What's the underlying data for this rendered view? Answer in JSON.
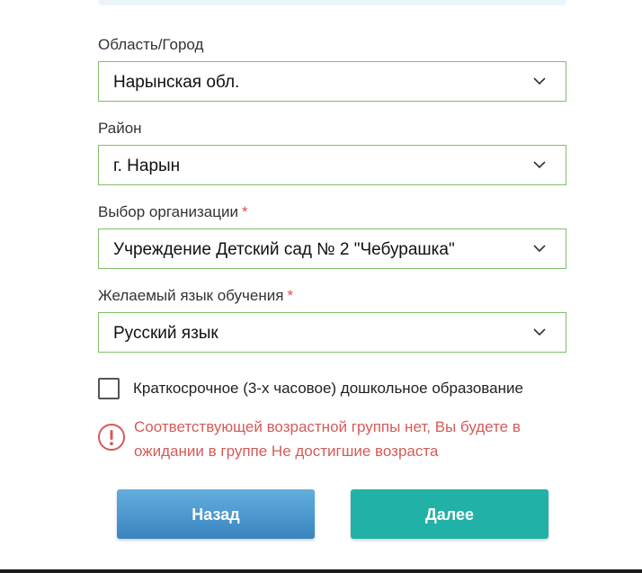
{
  "form": {
    "region": {
      "label": "Область/Город",
      "value": "Нарынская обл."
    },
    "district": {
      "label": "Район",
      "value": "г. Нарын"
    },
    "organization": {
      "label": "Выбор организации",
      "required_mark": "*",
      "value": "Учреждение Детский сад № 2 \"Чебурашка\""
    },
    "language": {
      "label": "Желаемый язык обучения",
      "required_mark": "*",
      "value": "Русский язык"
    },
    "short_term": {
      "label": "Краткосрочное (3-х часовое) дошкольное образование",
      "checked": false
    },
    "warning": {
      "icon": "exclamation-circle-icon",
      "text": "Соответствующей возрастной группы нет, Вы будете в ожидании в группе Не достигшие возраста"
    }
  },
  "buttons": {
    "back_label": "Назад",
    "next_label": "Далее"
  },
  "colors": {
    "select_border": "#7fbf6a",
    "required": "#d9534f",
    "warning": "#d45b58",
    "back_button": "#4a97cf",
    "next_button": "#21b1a6"
  }
}
